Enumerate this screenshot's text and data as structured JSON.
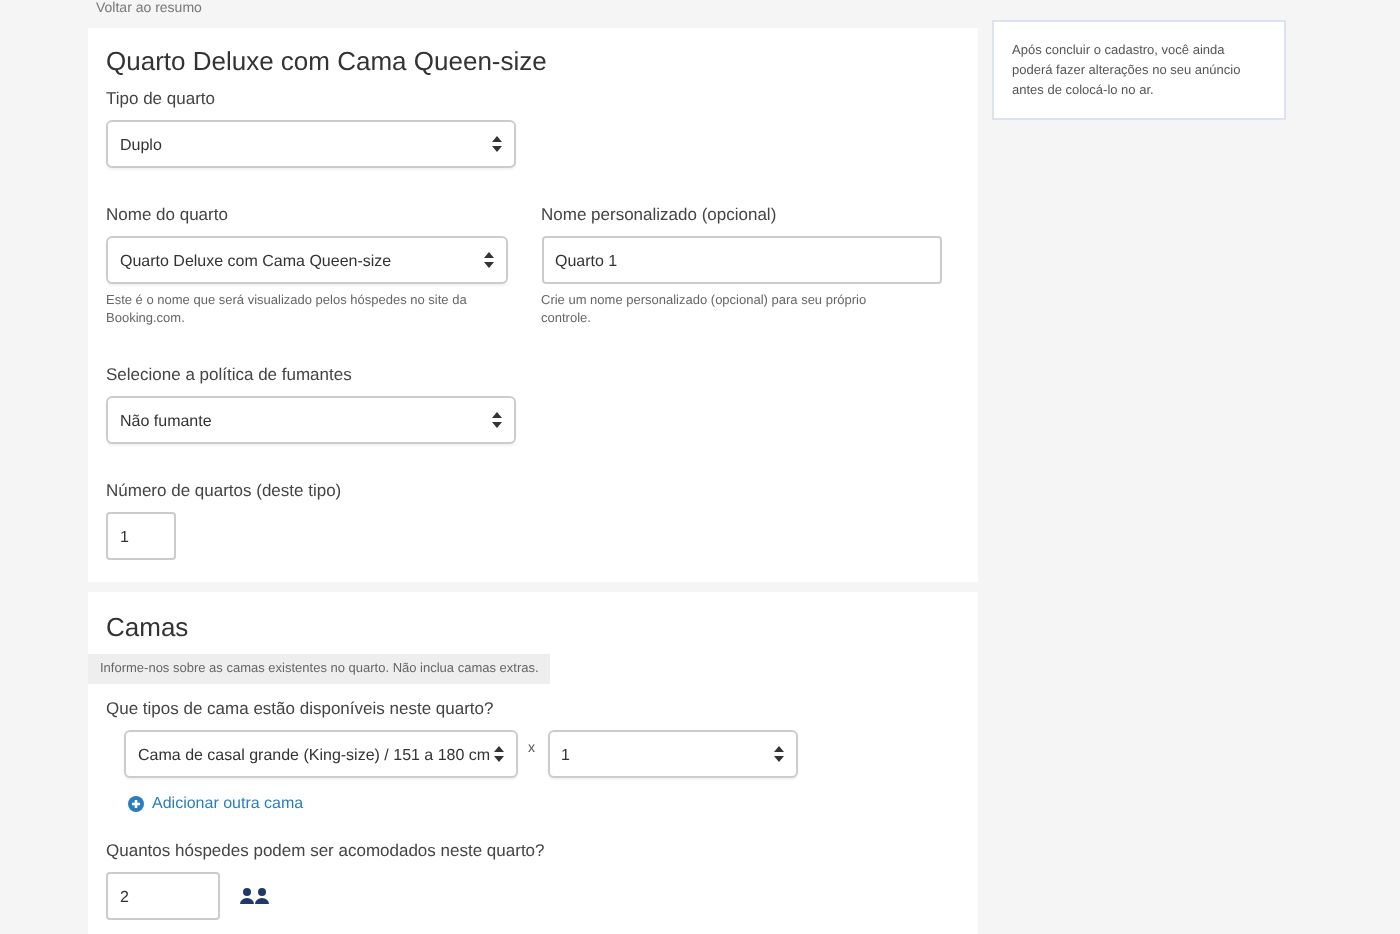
{
  "back_link": "Voltar ao resumo",
  "room": {
    "title": "Quarto Deluxe com Cama Queen-size",
    "room_type": {
      "label": "Tipo de quarto",
      "value": "Duplo"
    },
    "room_name": {
      "label": "Nome do quarto",
      "value": "Quarto Deluxe com Cama Queen-size",
      "help": "Este é o nome que será visualizado pelos hóspedes no site da Booking.com."
    },
    "custom_name": {
      "label": "Nome personalizado (opcional)",
      "value": "Quarto 1",
      "help": "Crie um nome personalizado (opcional) para seu próprio controle."
    },
    "smoking": {
      "label": "Selecione a política de fumantes",
      "value": "Não fumante"
    },
    "room_count": {
      "label": "Número de quartos (deste tipo)",
      "value": "1"
    }
  },
  "beds": {
    "title": "Camas",
    "info": "Informe-nos sobre as camas existentes no quarto. Não inclua camas extras.",
    "question": "Que tipos de cama estão disponíveis neste quarto?",
    "bed_rows": [
      {
        "type": "Cama de casal grande (King-size)  /  151 a 180 cm",
        "times": "x",
        "count": "1"
      }
    ],
    "add_bed": "Adicionar outra cama",
    "guests": {
      "label": "Quantos hóspedes podem ser acomodados neste quarto?",
      "value": "2"
    }
  },
  "side_note": "Após concluir o cadastro, você ainda poderá fazer alterações no seu anúncio antes de colocá-lo no ar."
}
